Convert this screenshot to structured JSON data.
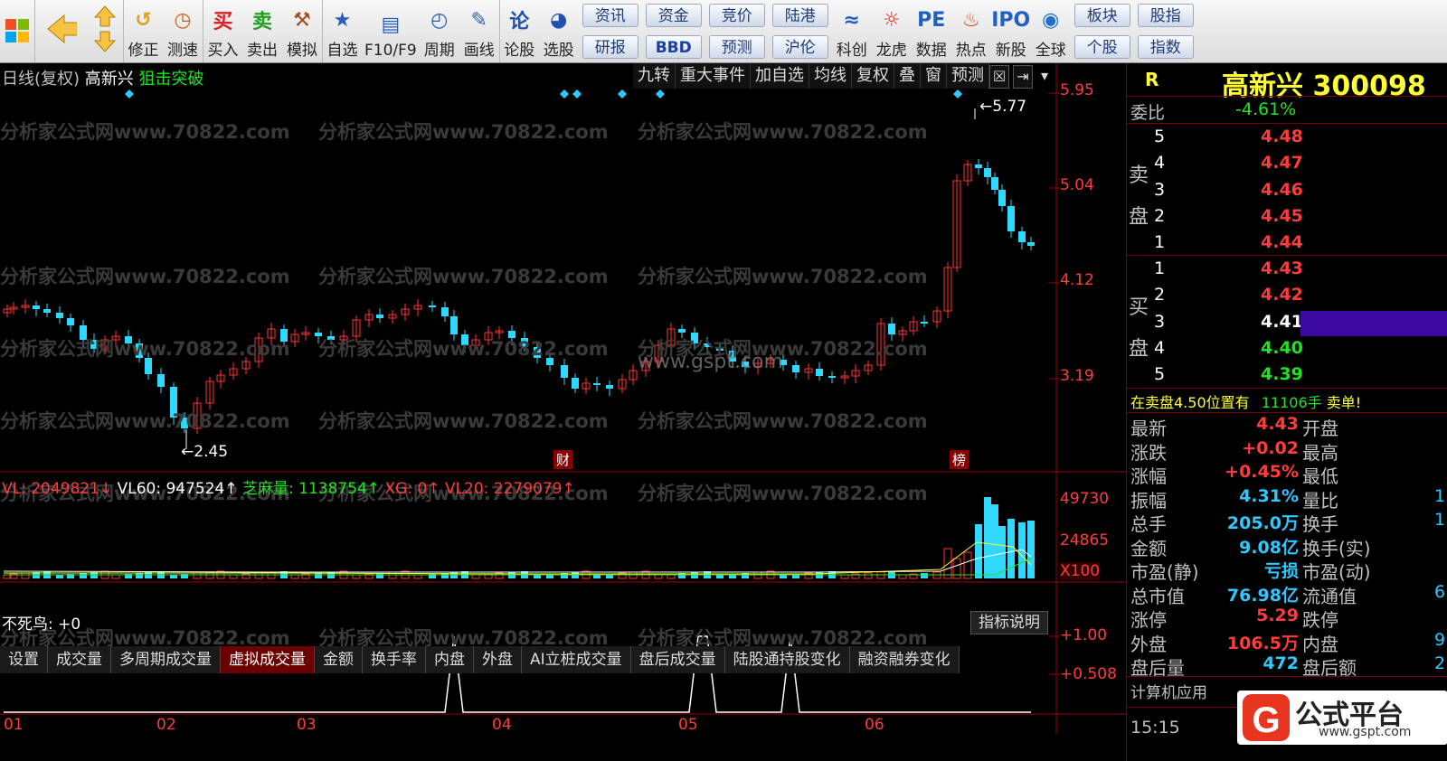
{
  "toolbar": {
    "items": [
      {
        "label": "修正",
        "icon": "undo-icon"
      },
      {
        "label": "测速",
        "icon": "clock-icon"
      },
      {
        "label": "买入",
        "icon": "buy-icon"
      },
      {
        "label": "卖出",
        "icon": "sell-icon"
      },
      {
        "label": "模拟",
        "icon": "gavel-icon"
      },
      {
        "label": "自选",
        "icon": "star-icon"
      },
      {
        "label": "F10/F9",
        "icon": "f10-icon"
      },
      {
        "label": "周期",
        "icon": "period-icon"
      },
      {
        "label": "画线",
        "icon": "pen-icon"
      },
      {
        "label": "论股",
        "icon": "discuss-icon"
      },
      {
        "label": "选股",
        "icon": "select-icon"
      }
    ],
    "pair_buttons": [
      [
        "资讯",
        "研报"
      ],
      [
        "资金",
        "BBD"
      ],
      [
        "竞价",
        "预测"
      ],
      [
        "陆港",
        "沪伦"
      ]
    ],
    "items2": [
      {
        "label": "科创",
        "icon": "kc-icon"
      },
      {
        "label": "龙虎",
        "icon": "dragon-icon"
      },
      {
        "label": "数据",
        "icon": "pe-icon"
      },
      {
        "label": "热点",
        "icon": "hot-icon"
      },
      {
        "label": "新股",
        "icon": "ipo-icon"
      },
      {
        "label": "全球",
        "icon": "globe-icon"
      }
    ],
    "pair_buttons2": [
      [
        "板块",
        "个股"
      ],
      [
        "股指",
        "指数"
      ]
    ]
  },
  "chart": {
    "period_label": "日线(复权)",
    "stock_name": "高新兴",
    "strategy": "狙击突破",
    "menu": [
      "九转",
      "重大事件",
      "加自选",
      "均线",
      "复权",
      "叠",
      "窗",
      "预测"
    ],
    "price_axis": [
      "5.95",
      "5.04",
      "4.12",
      "3.19"
    ],
    "high_label": "5.77",
    "low_label": "2.45",
    "event_cai": "财",
    "event_bang": "榜",
    "watermark": "分析家公式网www.70822.com",
    "watermark2": "www.gspt.com",
    "vol_legend": {
      "vl": "VL: 2049821↓",
      "vl60": "VL60: 947524↑",
      "zm": "芝麻量: 1138754↑",
      "xg": "XG: 0↑",
      "vl20": "VL20: 2279079↑"
    },
    "vol_axis": [
      "49730",
      "24865",
      "X100"
    ],
    "tabs": [
      "设置",
      "成交量",
      "多周期成交量",
      "虚拟成交量",
      "金额",
      "换手率",
      "内盘",
      "外盘",
      "AI立桩成交量",
      "盘后成交量",
      "陆股通持股变化",
      "融资融券变化"
    ],
    "indicator_name": "不死鸟: +0",
    "indicator_btn": "指标说明",
    "ind_axis": [
      "+1.00",
      "+0.508"
    ],
    "months": [
      "01",
      "02",
      "03",
      "04",
      "05",
      "06"
    ]
  },
  "quote": {
    "R": "R",
    "name": "高新兴",
    "code": "300098",
    "weibi_label": "委比",
    "weibi": "-4.61%",
    "sell_label": [
      "卖",
      "盘"
    ],
    "buy_label": [
      "买",
      "盘"
    ],
    "sell": [
      {
        "n": "5",
        "p": "4.48"
      },
      {
        "n": "4",
        "p": "4.47"
      },
      {
        "n": "3",
        "p": "4.46"
      },
      {
        "n": "2",
        "p": "4.45"
      },
      {
        "n": "1",
        "p": "4.44"
      }
    ],
    "buy": [
      {
        "n": "1",
        "p": "4.43"
      },
      {
        "n": "2",
        "p": "4.42"
      },
      {
        "n": "3",
        "p": "4.41"
      },
      {
        "n": "4",
        "p": "4.40"
      },
      {
        "n": "5",
        "p": "4.39"
      }
    ],
    "alert": "在卖盘4.50位置有",
    "alert_vol": "11106手",
    "alert_tail": "卖单!",
    "stats": [
      [
        "最新",
        "4.43",
        "开盘"
      ],
      [
        "涨跌",
        "+0.02",
        "最高"
      ],
      [
        "涨幅",
        "+0.45%",
        "最低"
      ],
      [
        "振幅",
        "4.31%",
        "量比"
      ],
      [
        "总手",
        "205.0万",
        "换手"
      ],
      [
        "金额",
        "9.08亿",
        "换手(实)"
      ],
      [
        "市盈(静)",
        "亏损",
        "市盈(动)"
      ],
      [
        "总市值",
        "76.98亿",
        "流通值"
      ],
      [
        "涨停",
        "5.29",
        "跌停"
      ],
      [
        "外盘",
        "106.5万",
        "内盘"
      ],
      [
        "盘后量",
        "472",
        "盘后额"
      ]
    ],
    "stat_right_vals": [
      "1",
      "1",
      "6",
      "9",
      "2"
    ],
    "industry": "计算机应用",
    "time": "15:15",
    "logo_text": "公式平台",
    "logo_url": "www.gspt.com"
  }
}
